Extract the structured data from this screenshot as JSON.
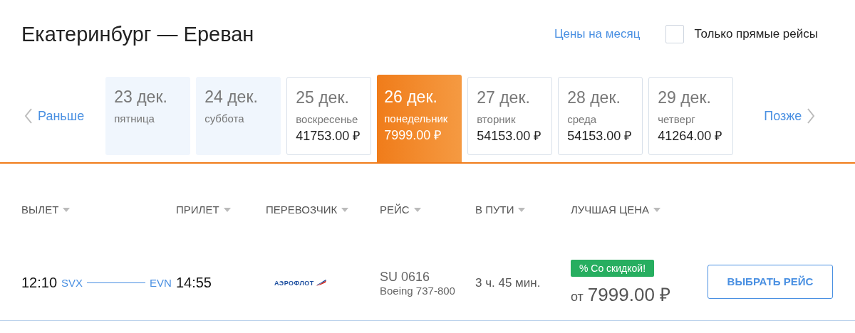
{
  "title": "Екатеринбург — Ереван",
  "month_prices_link": "Цены на месяц",
  "direct_only": {
    "label": "Только прямые рейсы",
    "checked": false
  },
  "nav": {
    "earlier": "Раньше",
    "later": "Позже"
  },
  "days": [
    {
      "date": "23 дек.",
      "weekday": "пятница",
      "available": false,
      "selected": false
    },
    {
      "date": "24 дек.",
      "weekday": "суббота",
      "available": false,
      "selected": false
    },
    {
      "date": "25 дек.",
      "weekday": "воскресенье",
      "price": "41753.00 ₽",
      "available": true,
      "selected": false
    },
    {
      "date": "26 дек.",
      "weekday": "понедельник",
      "price": "7999.00 ₽",
      "available": true,
      "selected": true
    },
    {
      "date": "27 дек.",
      "weekday": "вторник",
      "price": "54153.00 ₽",
      "available": true,
      "selected": false
    },
    {
      "date": "28 дек.",
      "weekday": "среда",
      "price": "54153.00 ₽",
      "available": true,
      "selected": false
    },
    {
      "date": "29 дек.",
      "weekday": "четверг",
      "price": "41264.00 ₽",
      "available": true,
      "selected": false
    }
  ],
  "columns": [
    "ВЫЛЕТ",
    "ПРИЛЕТ",
    "ПЕРЕВОЗЧИК",
    "РЕЙС",
    "В ПУТИ",
    "ЛУЧШАЯ ЦЕНА"
  ],
  "flights": [
    {
      "departure_time": "12:10",
      "departure_code": "SVX",
      "arrival_code": "EVN",
      "arrival_time": "14:55",
      "carrier_logo": "АЭРОФЛОТ",
      "flight_number": "SU 0616",
      "aircraft": "Boeing 737-800",
      "duration": "3 ч. 45 мин.",
      "badge": "% Со скидкой!",
      "price_prefix": "от",
      "price": "7999.00 ₽",
      "button": "ВЫБРАТЬ РЕЙС"
    }
  ]
}
